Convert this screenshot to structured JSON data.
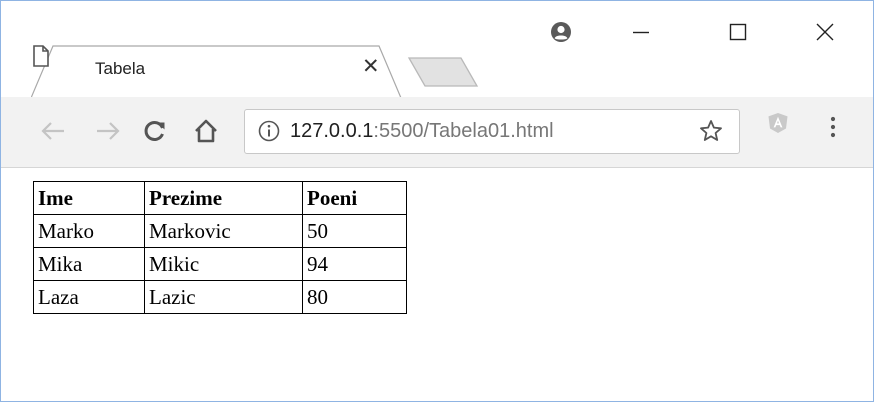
{
  "browser": {
    "tab": {
      "title": "Tabela"
    },
    "url": {
      "host": "127.0.0.1",
      "rest": ":5500/Tabela01.html"
    }
  },
  "icons": {
    "tab": "page-icon",
    "close": "close-icon",
    "account": "account-icon",
    "back": "back-arrow-icon",
    "forward": "forward-arrow-icon",
    "reload": "reload-icon",
    "home": "home-icon",
    "info": "info-icon",
    "bookmark": "star-icon",
    "extension": "angular-extension-icon",
    "menu": "kebab-menu-icon"
  },
  "table": {
    "headers": [
      "Ime",
      "Prezime",
      "Poeni"
    ],
    "rows": [
      [
        "Marko",
        "Markovic",
        "50"
      ],
      [
        "Mika",
        "Mikic",
        "94"
      ],
      [
        "Laza",
        "Lazic",
        "80"
      ]
    ]
  }
}
